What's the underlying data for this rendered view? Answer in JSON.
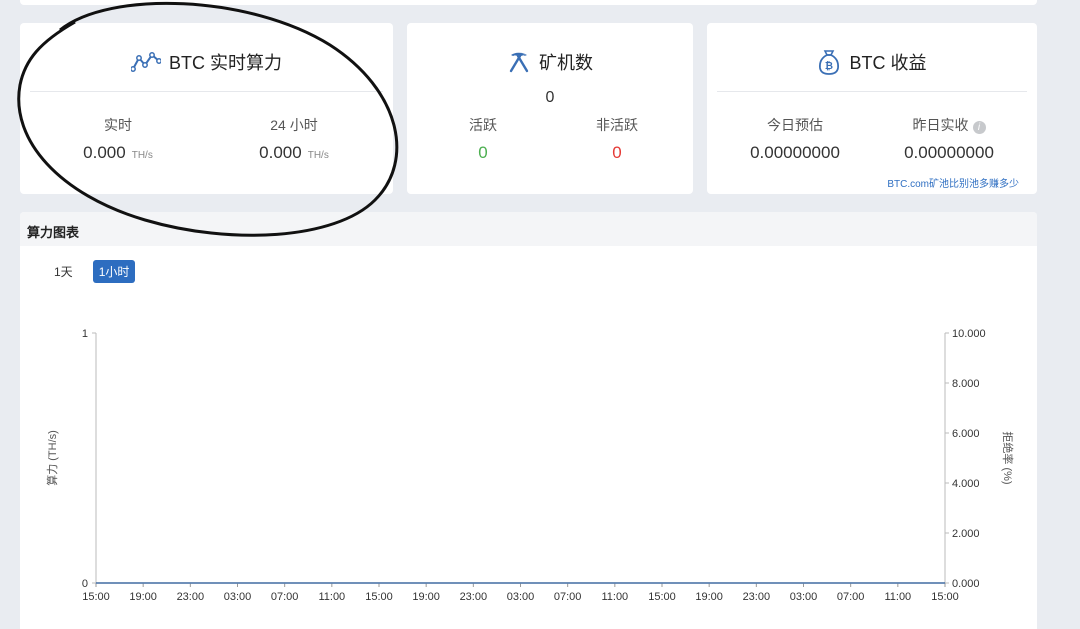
{
  "hashrate_card": {
    "title": "BTC 实时算力",
    "realtime_label": "实时",
    "realtime_value": "0.000",
    "realtime_unit": "TH/s",
    "day_label": "24 小时",
    "day_value": "0.000",
    "day_unit": "TH/s"
  },
  "miners_card": {
    "title": "矿机数",
    "total": "0",
    "active_label": "活跃",
    "active_value": "0",
    "inactive_label": "非活跃",
    "inactive_value": "0"
  },
  "earnings_card": {
    "title": "BTC 收益",
    "today_label": "今日预估",
    "today_value": "0.00000000",
    "yesterday_label": "昨日实收",
    "yesterday_value": "0.00000000",
    "compare_link": "BTC.com矿池比别池多赚多少"
  },
  "chart_panel": {
    "title": "算力图表",
    "tabs": [
      {
        "label": "1天",
        "active": false
      },
      {
        "label": "1小时",
        "active": true
      }
    ]
  },
  "colors": {
    "accent": "#2d6dc0",
    "active_green": "#4caf50",
    "inactive_red": "#e53935"
  },
  "chart_data": {
    "type": "line",
    "title": "",
    "x": [
      "15:00",
      "19:00",
      "23:00",
      "03:00",
      "07:00",
      "11:00",
      "15:00",
      "19:00",
      "23:00",
      "03:00",
      "07:00",
      "11:00",
      "15:00",
      "19:00",
      "23:00",
      "03:00",
      "07:00",
      "11:00",
      "15:00"
    ],
    "y_left_label": "算力 (TH/s)",
    "y_left_ticks": [
      "0",
      "1"
    ],
    "y_left_range": [
      0,
      1
    ],
    "y_right_label": "拒绝率 (%)",
    "y_right_ticks": [
      "0.000",
      "2.000",
      "4.000",
      "6.000",
      "8.000",
      "10.000"
    ],
    "y_right_range": [
      0,
      10
    ],
    "series": [
      {
        "values": [
          0,
          0,
          0,
          0,
          0,
          0,
          0,
          0,
          0,
          0,
          0,
          0,
          0,
          0,
          0,
          0,
          0,
          0,
          0
        ],
        "axis": "left"
      }
    ],
    "grid": false
  }
}
